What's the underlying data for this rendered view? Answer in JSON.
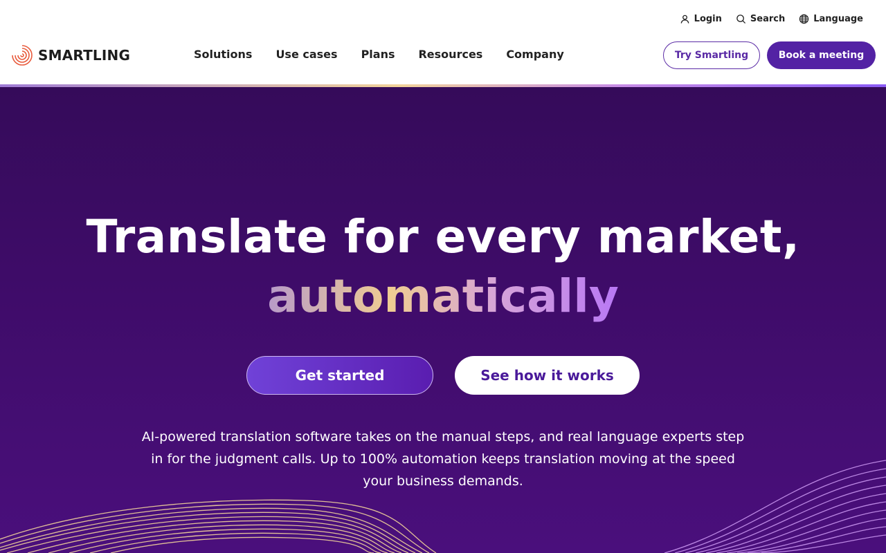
{
  "utility": {
    "login": "Login",
    "search": "Search",
    "language": "Language"
  },
  "brand": {
    "name": "SMARTLING",
    "logo_color": "#e85a3c"
  },
  "nav": {
    "items": [
      "Solutions",
      "Use cases",
      "Plans",
      "Resources",
      "Company"
    ]
  },
  "header_buttons": {
    "try": "Try Smartling",
    "book": "Book a meeting"
  },
  "hero": {
    "headline_line1": "Translate for every market,",
    "headline_line2": "automatically",
    "cta_primary": "Get started",
    "cta_secondary": "See how it works",
    "subcopy": "AI-powered translation software takes on the manual steps, and real language experts step in for the judgment calls. Up to 100% automation keeps translation moving at the speed your business demands."
  },
  "colors": {
    "brand_purple": "#5322a4",
    "hero_bg": "#3e0c68",
    "wave_left": "#f2d39a",
    "wave_right": "#c995f0"
  }
}
